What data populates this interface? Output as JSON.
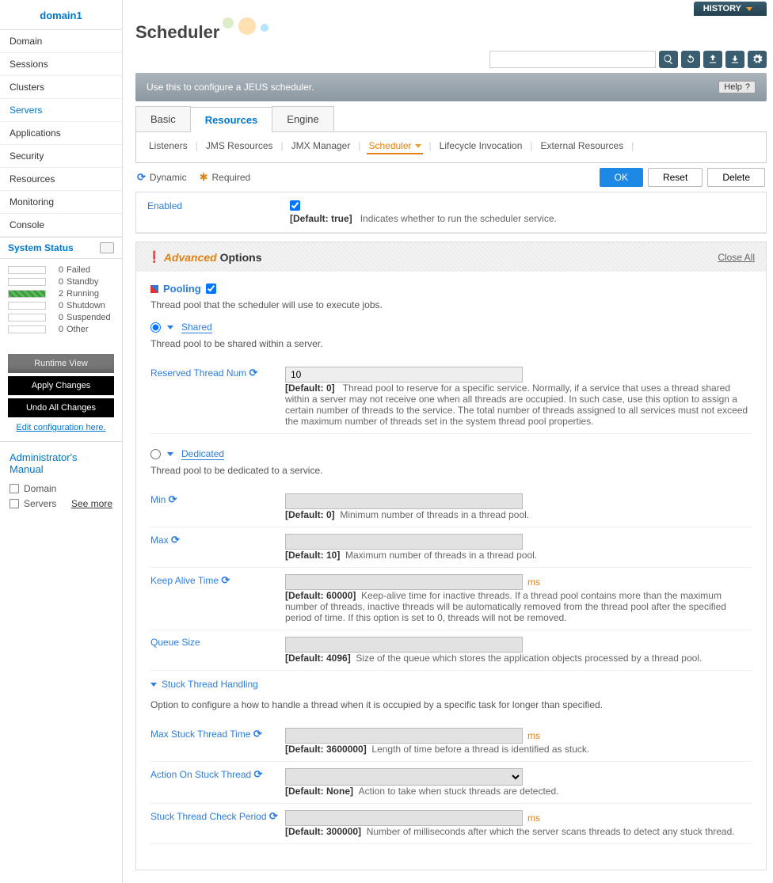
{
  "domain": "domain1",
  "nav": [
    "Domain",
    "Sessions",
    "Clusters",
    "Servers",
    "Applications",
    "Security",
    "Resources",
    "Monitoring",
    "Console"
  ],
  "nav_active": "Servers",
  "systemStatus": {
    "title": "System Status",
    "rows": [
      {
        "count": "0",
        "label": "Failed",
        "running": false
      },
      {
        "count": "0",
        "label": "Standby",
        "running": false
      },
      {
        "count": "2",
        "label": "Running",
        "running": true
      },
      {
        "count": "0",
        "label": "Shutdown",
        "running": false
      },
      {
        "count": "0",
        "label": "Suspended",
        "running": false
      },
      {
        "count": "0",
        "label": "Other",
        "running": false
      }
    ]
  },
  "sideButtons": {
    "runtime": "Runtime View",
    "apply": "Apply Changes",
    "undo": "Undo All Changes",
    "edit": "Edit configuration here."
  },
  "manual": {
    "title": "Administrator's Manual",
    "items": [
      "Domain",
      "Servers"
    ],
    "more": "See more"
  },
  "history": "HISTORY",
  "pageTitle": "Scheduler",
  "descBar": "Use this to configure a JEUS scheduler.",
  "help": "Help",
  "primaryTabs": [
    "Basic",
    "Resources",
    "Engine"
  ],
  "primaryActive": "Resources",
  "subTabs": [
    "Listeners",
    "JMS Resources",
    "JMX Manager",
    "Scheduler",
    "Lifecycle Invocation",
    "External Resources"
  ],
  "subActive": "Scheduler",
  "flags": {
    "dynamic": "Dynamic",
    "required": "Required"
  },
  "buttons": {
    "ok": "OK",
    "reset": "Reset",
    "delete": "Delete"
  },
  "enabled": {
    "label": "Enabled",
    "def": "[Default: true]",
    "hint": "Indicates whether to run the scheduler service."
  },
  "adv": {
    "accent": "Advanced",
    "title": " Options",
    "close": "Close All"
  },
  "pooling": {
    "title": "Pooling",
    "desc": "Thread pool that the scheduler will use to execute jobs.",
    "shared": {
      "label": "Shared",
      "desc": "Thread pool to be shared within a server.",
      "reserved": {
        "label": "Reserved Thread Num",
        "value": "10",
        "def": "[Default: 0]",
        "hint": "Thread pool to reserve for a specific service. Normally, if a service that uses a thread shared within a server may not receive one when all threads are occupied. In such case, use this option to assign a certain number of threads to the service. The total number of threads assigned to all services must not exceed the maximum number of threads set in the system thread pool properties."
      }
    },
    "dedicated": {
      "label": "Dedicated",
      "desc": "Thread pool to be dedicated to a service.",
      "min": {
        "label": "Min",
        "def": "[Default: 0]",
        "hint": "Minimum number of threads in a thread pool."
      },
      "max": {
        "label": "Max",
        "def": "[Default: 10]",
        "hint": "Maximum number of threads in a thread pool."
      },
      "keepalive": {
        "label": "Keep Alive Time",
        "unit": "ms",
        "def": "[Default: 60000]",
        "hint": "Keep-alive time for inactive threads. If a thread pool contains more than the maximum number of threads, inactive threads will be automatically removed from the thread pool after the specified period of time. If this option is set to 0, threads will not be removed."
      },
      "queue": {
        "label": "Queue Size",
        "def": "[Default: 4096]",
        "hint": "Size of the queue which stores the application objects processed by a thread pool."
      },
      "stuckSection": {
        "label": "Stuck Thread Handling",
        "desc": "Option to configure a how to handle a thread when it is occupied by a specific task for longer than specified."
      },
      "maxStuck": {
        "label": "Max Stuck Thread Time",
        "unit": "ms",
        "def": "[Default: 3600000]",
        "hint": "Length of time before a thread is identified as stuck."
      },
      "action": {
        "label": "Action On Stuck Thread",
        "def": "[Default: None]",
        "hint": "Action to take when stuck threads are detected."
      },
      "check": {
        "label": "Stuck Thread Check Period",
        "unit": "ms",
        "def": "[Default: 300000]",
        "hint": "Number of milliseconds after which the server scans threads to detect any stuck thread."
      }
    }
  }
}
